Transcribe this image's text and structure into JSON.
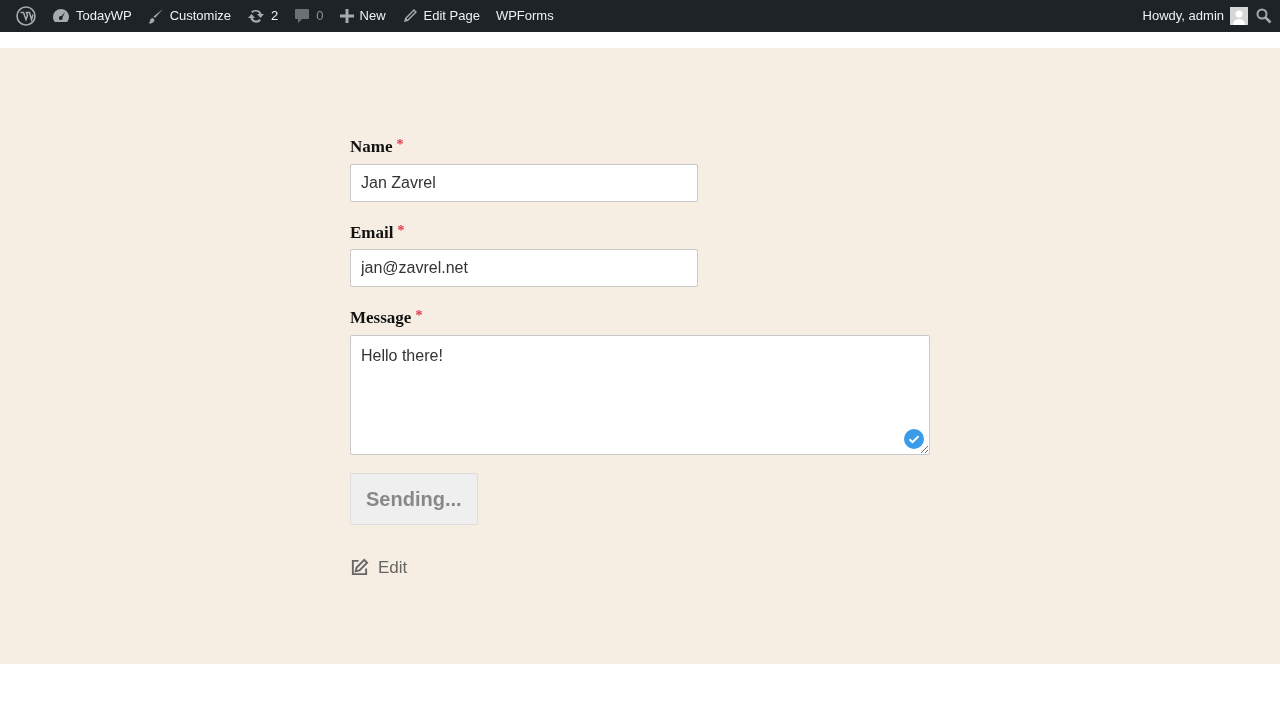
{
  "admin_bar": {
    "left": [
      {
        "muted": false
      },
      {
        "label": "TodayWP",
        "muted": false
      },
      {
        "label": "Customize",
        "muted": false
      },
      {
        "label": "2",
        "muted": false
      },
      {
        "label": "0",
        "muted": true
      },
      {
        "label": "New",
        "muted": false
      },
      {
        "label": "Edit Page",
        "muted": false
      },
      {
        "label": "WPForms",
        "muted": false
      }
    ],
    "account": {
      "label": "Howdy, admin"
    }
  },
  "form": {
    "fields": [
      {
        "kind": "input",
        "label": "Name",
        "required_mark": "*",
        "value": "Jan Zavrel",
        "validated": false
      },
      {
        "kind": "input",
        "label": "Email",
        "required_mark": "*",
        "value": "jan@zavrel.net",
        "validated": false
      },
      {
        "kind": "textarea",
        "label": "Message",
        "required_mark": "*",
        "value": "Hello there!",
        "validated": true
      }
    ],
    "submit": {
      "label": "Sending...",
      "disabled": true
    },
    "edit_link": {
      "label": "Edit"
    }
  }
}
